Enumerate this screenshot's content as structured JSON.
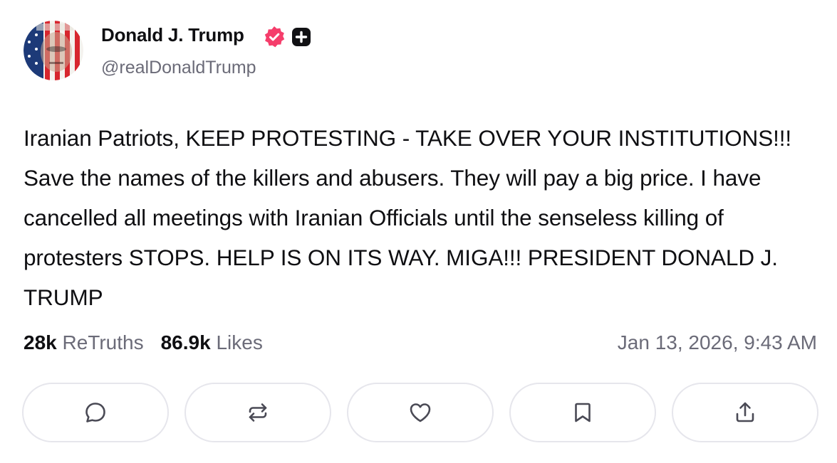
{
  "author": {
    "display_name": "Donald J. Trump",
    "handle": "@realDonaldTrump",
    "avatar_icon": "avatar-flag-portrait",
    "verified_icon": "verified-badge-icon",
    "verified_color": "#f53d6b",
    "plus_icon": "truth-plus-icon"
  },
  "post": {
    "text": "Iranian Patriots, KEEP PROTESTING - TAKE OVER YOUR INSTITUTIONS!!! Save the names of the killers and abusers. They will pay a big price. I have cancelled all meetings with Iranian Officials until the senseless killing of protesters STOPS. HELP IS ON ITS WAY. MIGA!!! PRESIDENT DONALD J. TRUMP"
  },
  "stats": {
    "retruths_count": "28k",
    "retruths_label": "ReTruths",
    "likes_count": "86.9k",
    "likes_label": "Likes",
    "timestamp": "Jan 13, 2026, 9:43 AM"
  },
  "actions": [
    {
      "icon": "comment-icon"
    },
    {
      "icon": "retruth-icon"
    },
    {
      "icon": "heart-icon"
    },
    {
      "icon": "bookmark-icon"
    },
    {
      "icon": "share-icon"
    }
  ],
  "colors": {
    "text": "#0f0f12",
    "muted": "#6b6b78",
    "border": "#e6e6ec",
    "icon": "#4a4a55"
  }
}
